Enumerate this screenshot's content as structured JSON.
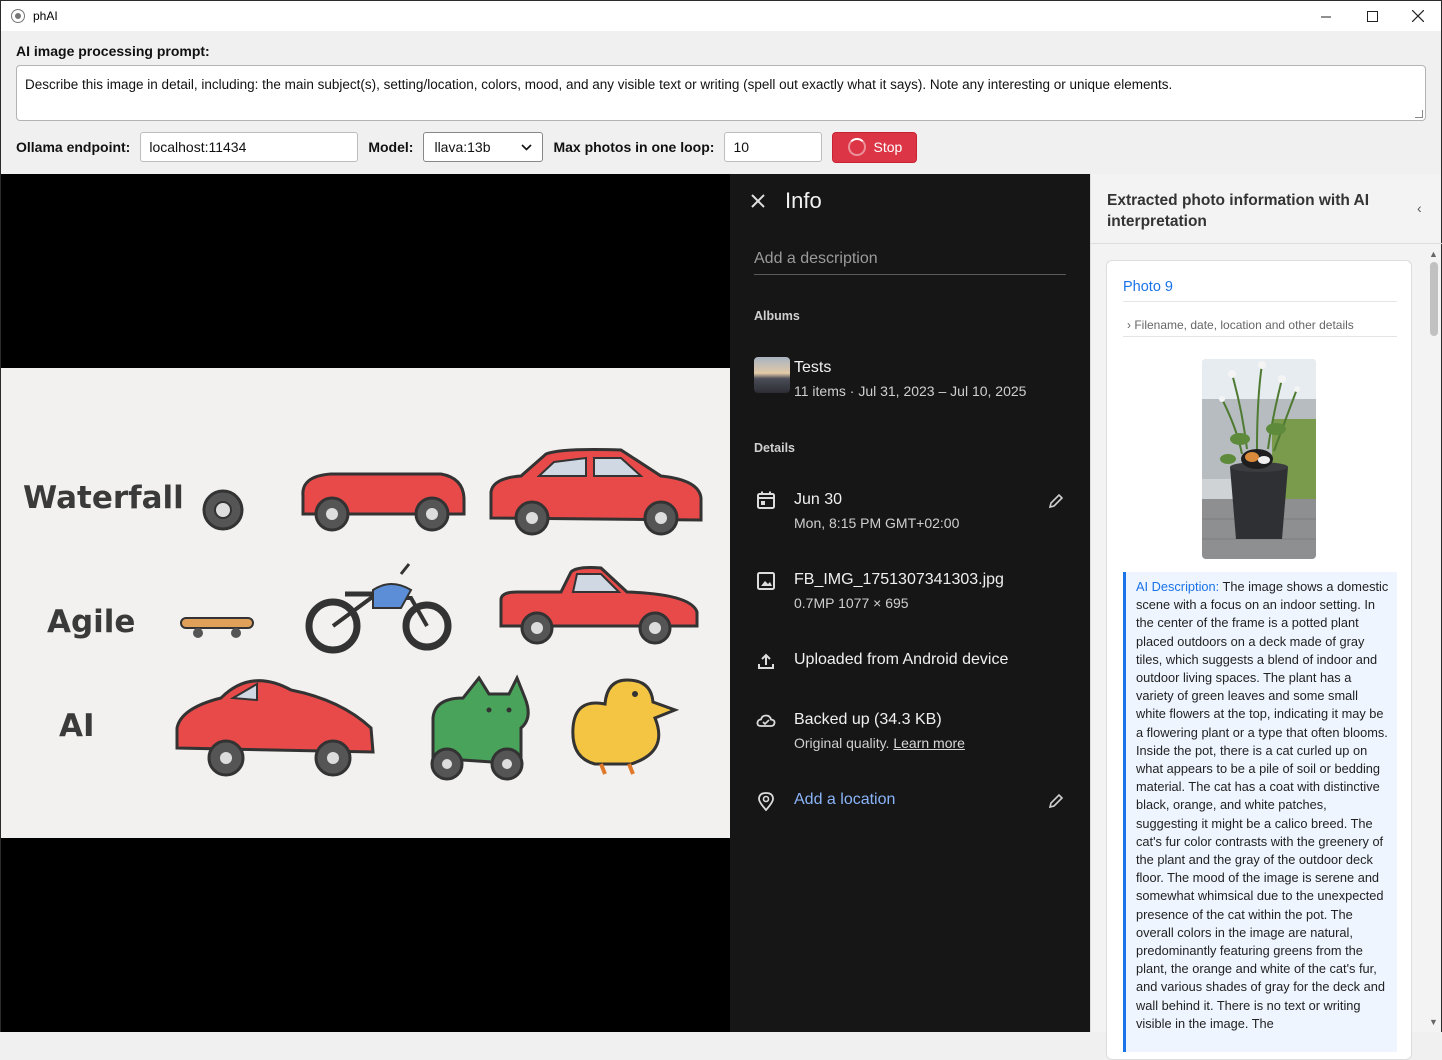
{
  "window": {
    "title": "phAI",
    "controls": {
      "minimize": "–",
      "maximize": "☐",
      "close": "✕"
    }
  },
  "prompt": {
    "label": "AI image processing prompt:",
    "value": "Describe this image in detail, including: the main subject(s), setting/location, colors, mood, and any visible text or writing (spell out exactly what it says). Note any interesting or unique elements."
  },
  "controls": {
    "endpoint_label": "Ollama endpoint:",
    "endpoint_value": "localhost:11434",
    "model_label": "Model:",
    "model_value": "llava:13b",
    "max_label": "Max photos in one loop:",
    "max_value": "10",
    "stop_label": "Stop"
  },
  "illustration": {
    "rows": [
      "Waterfall",
      "Agile",
      "AI"
    ]
  },
  "info": {
    "title": "Info",
    "description_placeholder": "Add a description",
    "albums_heading": "Albums",
    "album_name": "Tests",
    "album_meta": "11 items  ·  Jul 31, 2023 – Jul 10, 2025",
    "details_heading": "Details",
    "date": "Jun 30",
    "date_sub": "Mon, 8:15 PM   GMT+02:00",
    "filename": "FB_IMG_1751307341303.jpg",
    "file_sub": "0.7MP    1077 × 695",
    "uploaded": "Uploaded from Android device",
    "backup": "Backed up (34.3 KB)",
    "backup_sub": "Original quality. ",
    "learn_more": "Learn more",
    "add_location": "Add a location"
  },
  "right_panel": {
    "header": "Extracted photo information with AI interpretation",
    "chevron": "‹",
    "card_title": "Photo 9",
    "details_toggle": "›  Filename, date, location and other details",
    "ai_label": "AI Description:",
    "ai_text": "The image shows a domestic scene with a focus on an indoor setting. In the center of the frame is a potted plant placed outdoors on a deck made of gray tiles, which suggests a blend of indoor and outdoor living spaces. The plant has a variety of green leaves and some small white flowers at the top, indicating it may be a flowering plant or a type that often blooms. Inside the pot, there is a cat curled up on what appears to be a pile of soil or bedding material. The cat has a coat with distinctive black, orange, and white patches, suggesting it might be a calico breed. The cat's fur color contrasts with the greenery of the plant and the gray of the outdoor deck floor. The mood of the image is serene and somewhat whimsical due to the unexpected presence of the cat within the pot. The overall colors in the image are natural, predominantly featuring greens from the plant, the orange and white of the cat's fur, and various shades of gray for the deck and wall behind it. There is no text or writing visible in the image. The"
  },
  "colors": {
    "stop": "#dc3545",
    "link": "#1a73e8",
    "info_bg": "#161616",
    "car_red": "#e84a4a"
  }
}
